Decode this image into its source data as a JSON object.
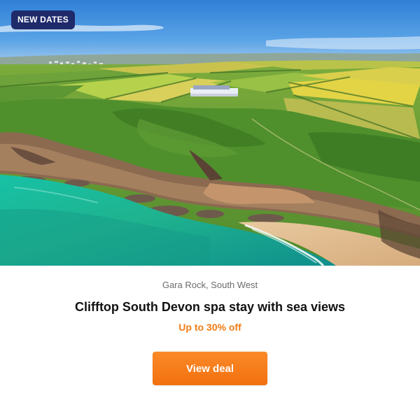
{
  "hero": {
    "image_name": "aerial-coastline-photo",
    "badge_label": "NEW DATES"
  },
  "deal": {
    "location": "Gara Rock, South West",
    "title": "Clifftop South Devon spa stay with sea views",
    "discount": "Up to 30% off",
    "cta_label": "View deal"
  },
  "colors": {
    "badge_bg": "#1f2a6b",
    "accent_orange": "#f07c15",
    "button_orange": "#f7801f",
    "sea_turquoise": "#1fb99a"
  }
}
